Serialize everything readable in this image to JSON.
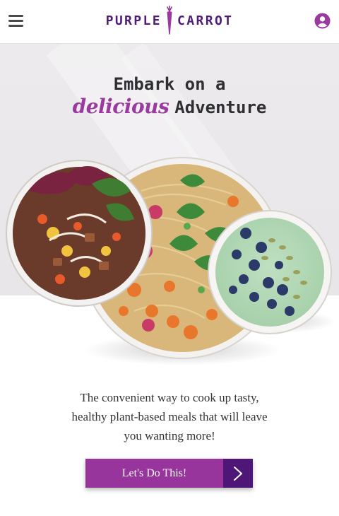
{
  "header": {
    "logo_left": "PURPLE",
    "logo_right": "CARROT",
    "menu_icon": "hamburger-menu-icon",
    "account_icon": "user-account-icon"
  },
  "hero": {
    "headline_line1": "Embark on a",
    "headline_script": "delicious",
    "headline_rest": "Adventure",
    "image": "three bowls of plant-based meals: salad bowl, noodle bowl, blueberry smoothie bowl"
  },
  "tagline": "The convenient way to cook up tasty, healthy plant-based meals that will leave you wanting more!",
  "cta": {
    "label": "Let's Do This!",
    "icon": "chevron-right-icon"
  },
  "colors": {
    "brand_purple": "#4e1d78",
    "accent_purple": "#97359c",
    "dark_purple": "#4e1677",
    "hero_bg": "#eceaec"
  }
}
